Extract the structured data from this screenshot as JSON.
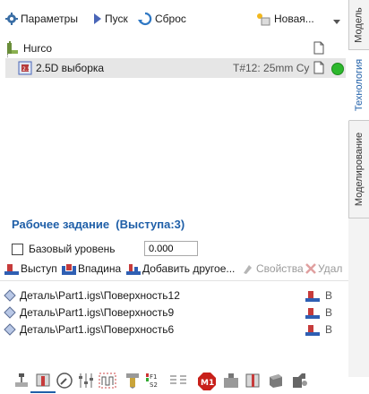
{
  "toolbar": {
    "params_label": "Параметры",
    "start_label": "Пуск",
    "reset_label": "Сброс",
    "new_label": "Новая..."
  },
  "tree": {
    "root_label": "Hurco",
    "op_label": "2.5D выборка",
    "op_tool": "T#12: 25mm Cу"
  },
  "tabs": [
    {
      "label": "Модель"
    },
    {
      "label": "Технология"
    },
    {
      "label": "Моделирование"
    }
  ],
  "job": {
    "title": "Рабочее задание  (Выступа:3)",
    "base_level_label": "Базовый уровень",
    "base_level_value": "0.000"
  },
  "actions": {
    "boss_label": "Выступ",
    "pocket_label": "Впадина",
    "add_other_label": "Добавить другое...",
    "props_label": "Свойства",
    "delete_label": "Удал"
  },
  "features": [
    {
      "label": "Деталь\\Part1.igs\\Поверхность12",
      "col": "В"
    },
    {
      "label": "Деталь\\Part1.igs\\Поверхность9",
      "col": "В"
    },
    {
      "label": "Деталь\\Part1.igs\\Поверхность6",
      "col": "В"
    }
  ],
  "colors": {
    "accent_blue": "#1f5fa8",
    "selected_row": "#e6e6e6",
    "status_green": "#2db82d"
  }
}
